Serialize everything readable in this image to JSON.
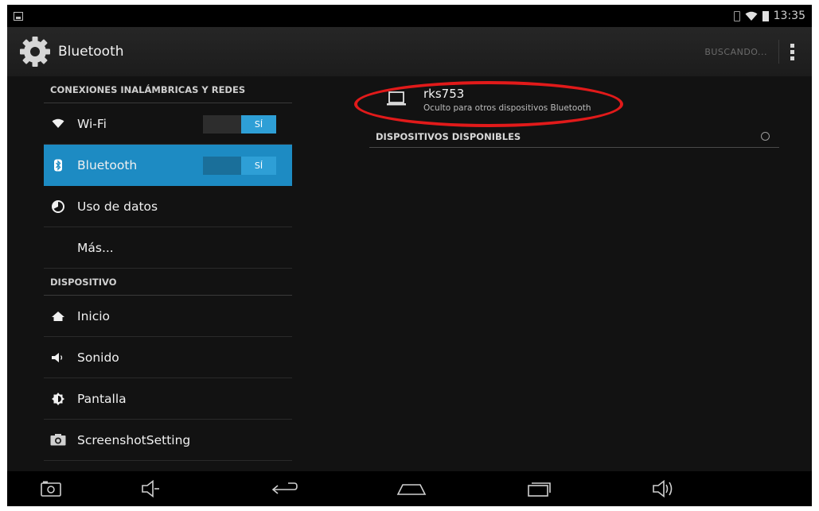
{
  "status_bar": {
    "time": "13:35"
  },
  "action_bar": {
    "title": "Bluetooth",
    "scan_label": "BUSCANDO..."
  },
  "sidebar": {
    "section_wireless": "CONEXIONES INALÁMBRICAS Y REDES",
    "wifi": {
      "label": "Wi-Fi",
      "toggle": "SÍ"
    },
    "bluetooth": {
      "label": "Bluetooth",
      "toggle": "SÍ"
    },
    "data_usage": {
      "label": "Uso de datos"
    },
    "more": {
      "label": "Más..."
    },
    "section_device": "DISPOSITIVO",
    "home": {
      "label": "Inicio"
    },
    "sound": {
      "label": "Sonido"
    },
    "display": {
      "label": "Pantalla"
    },
    "screenshot": {
      "label": "ScreenshotSetting"
    }
  },
  "main": {
    "device_name": "rks753",
    "device_status": "Oculto para otros dispositivos Bluetooth",
    "available_header": "DISPOSITIVOS DISPONIBLES"
  },
  "colors": {
    "accent": "#1d8bc3",
    "toggle_on": "#2e9fd6",
    "highlight_oval": "#e11a1a"
  }
}
